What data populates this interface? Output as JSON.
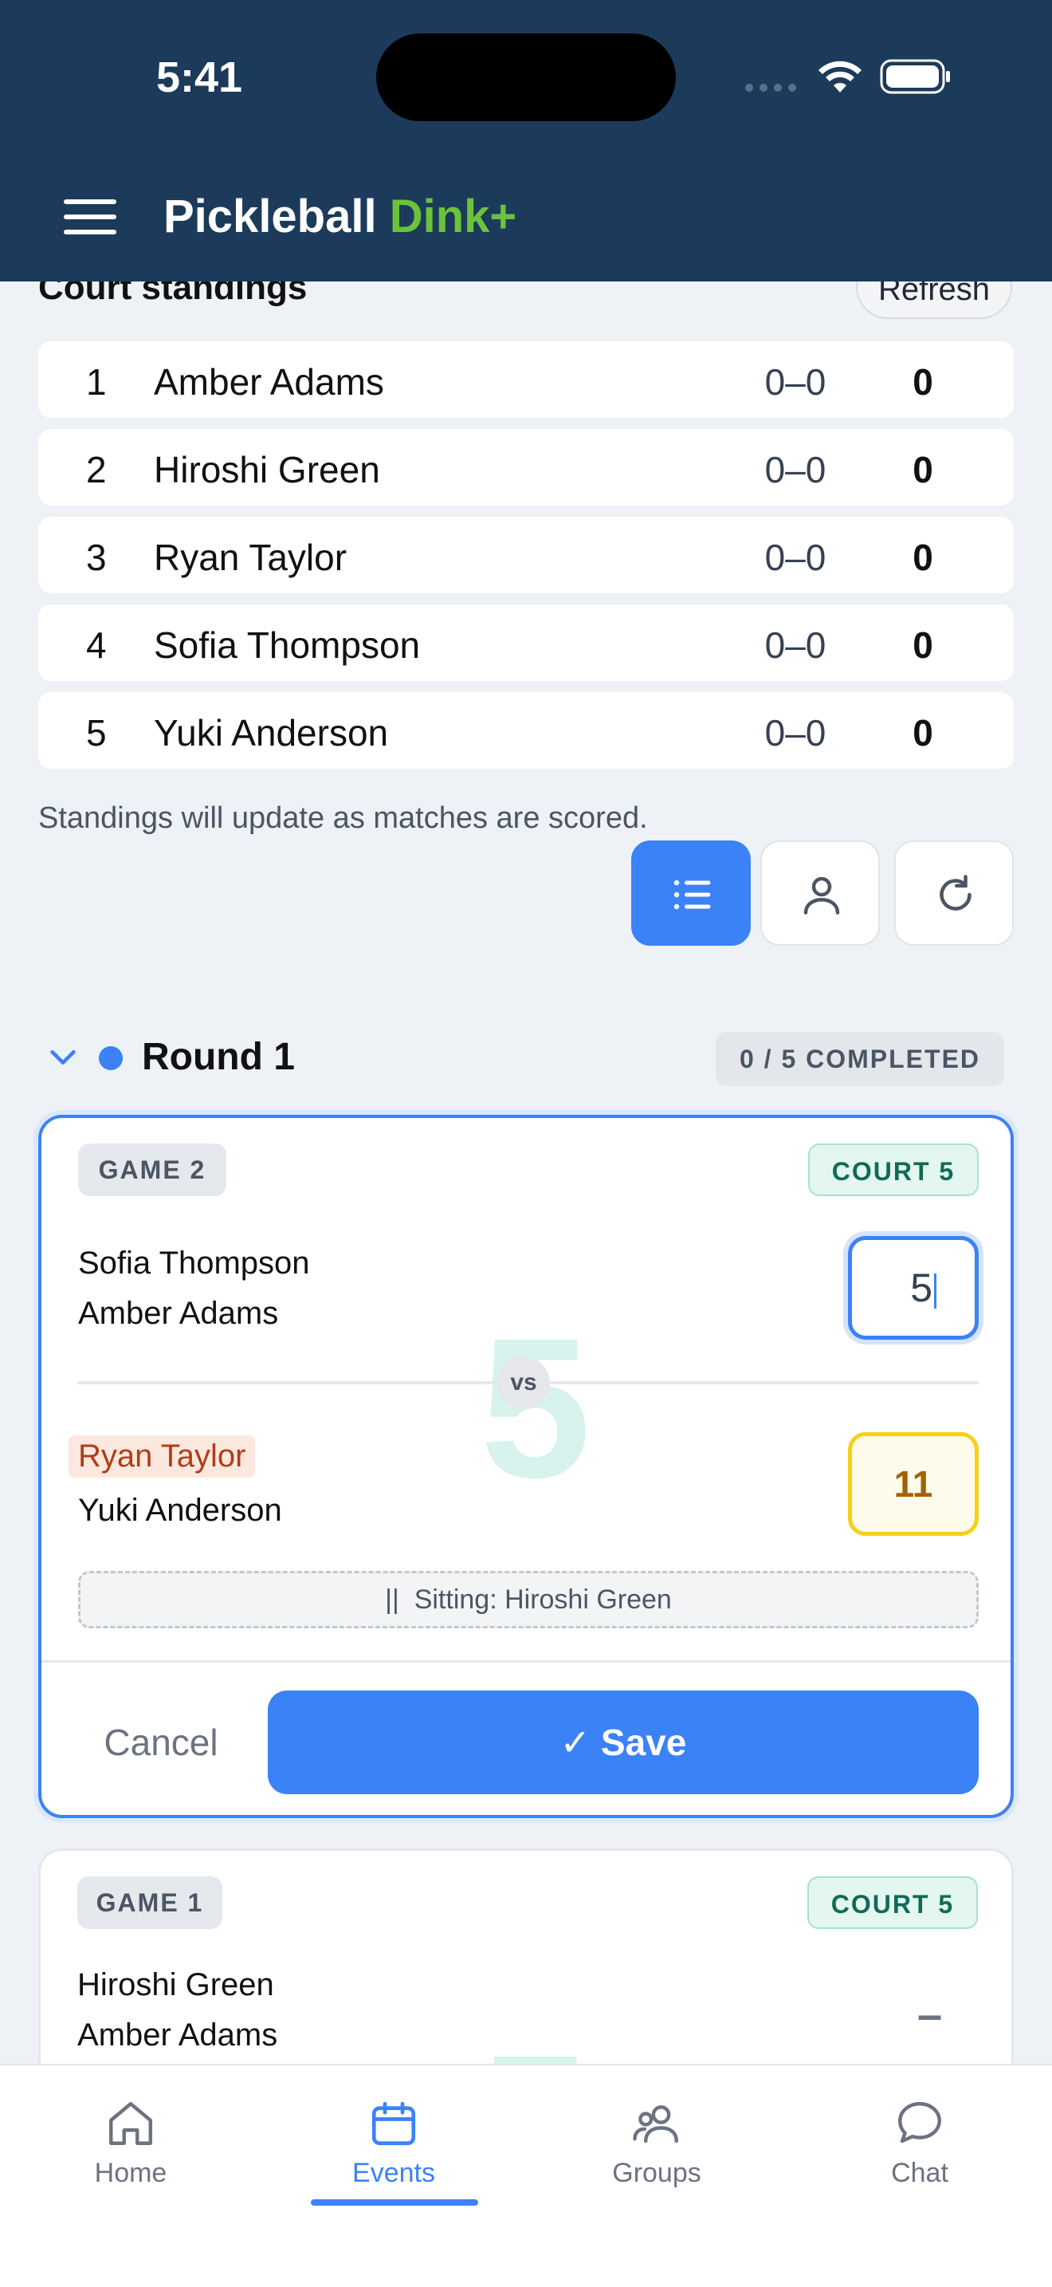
{
  "status_bar": {
    "time": "5:41"
  },
  "app": {
    "brand_main": "Pickleball",
    "brand_accent": "Dink+"
  },
  "standings": {
    "title": "Court standings",
    "refresh_label": "Refresh",
    "rows": [
      {
        "rank": "1",
        "name": "Amber Adams",
        "record": "0–0",
        "points": "0"
      },
      {
        "rank": "2",
        "name": "Hiroshi Green",
        "record": "0–0",
        "points": "0"
      },
      {
        "rank": "3",
        "name": "Ryan Taylor",
        "record": "0–0",
        "points": "0"
      },
      {
        "rank": "4",
        "name": "Sofia Thompson",
        "record": "0–0",
        "points": "0"
      },
      {
        "rank": "5",
        "name": "Yuki Anderson",
        "record": "0–0",
        "points": "0"
      }
    ],
    "note": "Standings will update as matches are scored.",
    "view_buttons": [
      "list-icon",
      "person-icon",
      "refresh-icon"
    ]
  },
  "round": {
    "title": "Round 1",
    "badge": "0 / 5 COMPLETED",
    "games": [
      {
        "game_label": "GAME 2",
        "court_label": "COURT 5",
        "court_number": "5",
        "team1": [
          "Sofia Thompson",
          "Amber Adams"
        ],
        "team1_score": "5",
        "vs": "vs",
        "team2": [
          "Ryan Taylor",
          "Yuki Anderson"
        ],
        "team2_score": "11",
        "sitting": "Sitting: Hiroshi Green",
        "cancel_label": "Cancel",
        "save_label": "✓ Save"
      },
      {
        "game_label": "GAME 1",
        "court_label": "COURT 5",
        "court_number": "5",
        "team1": [
          "Hiroshi Green",
          "Amber Adams"
        ],
        "team1_score": "–"
      }
    ]
  },
  "tabbar": {
    "tabs": [
      {
        "label": "Home",
        "icon": "home-icon"
      },
      {
        "label": "Events",
        "icon": "calendar-icon",
        "active": true
      },
      {
        "label": "Groups",
        "icon": "groups-icon"
      },
      {
        "label": "Chat",
        "icon": "chat-icon"
      }
    ]
  },
  "colors": {
    "header": "#1c3b5a",
    "accent": "#3b82f6",
    "brand_accent": "#6cc33b"
  }
}
